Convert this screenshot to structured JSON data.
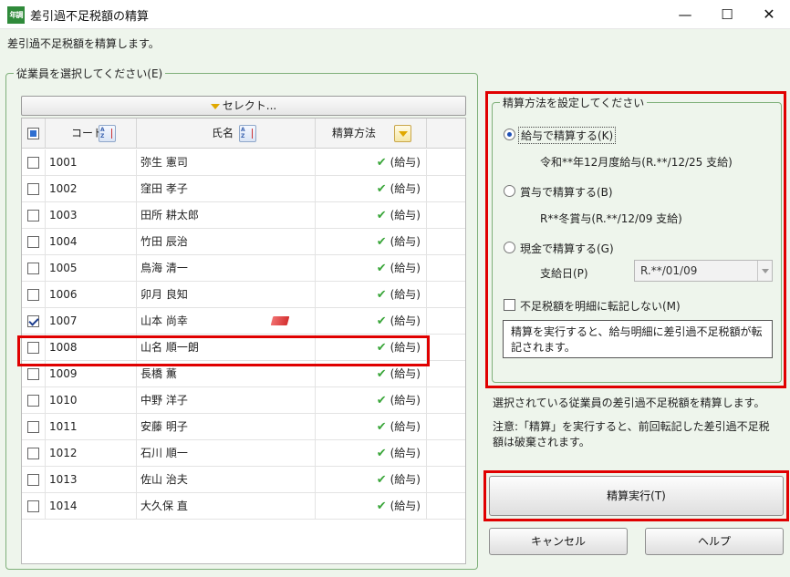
{
  "window": {
    "icon_text": "年調",
    "title": "差引過不足税額の精算",
    "minimize": "—",
    "maximize": "☐",
    "close": "✕"
  },
  "description": "差引過不足税額を精算します。",
  "employee_group": {
    "legend": "従業員を選択してください(E)",
    "select_button": "セレクト...",
    "columns": {
      "code": "コード",
      "name": "氏名",
      "method": "精算方法"
    },
    "rows": [
      {
        "code": "1001",
        "name": "弥生 憲司",
        "method": "(給与)",
        "checked": false
      },
      {
        "code": "1002",
        "name": "窪田 孝子",
        "method": "(給与)",
        "checked": false
      },
      {
        "code": "1003",
        "name": "田所 耕太郎",
        "method": "(給与)",
        "checked": false
      },
      {
        "code": "1004",
        "name": "竹田 辰治",
        "method": "(給与)",
        "checked": false
      },
      {
        "code": "1005",
        "name": "鳥海 清一",
        "method": "(給与)",
        "checked": false
      },
      {
        "code": "1006",
        "name": "卯月 良知",
        "method": "(給与)",
        "checked": false
      },
      {
        "code": "1007",
        "name": "山本 尚幸",
        "method": "(給与)",
        "checked": true
      },
      {
        "code": "1008",
        "name": "山名 順一朗",
        "method": "(給与)",
        "checked": false
      },
      {
        "code": "1009",
        "name": "長橋 薫",
        "method": "(給与)",
        "checked": false
      },
      {
        "code": "1010",
        "name": "中野 洋子",
        "method": "(給与)",
        "checked": false
      },
      {
        "code": "1011",
        "name": "安藤 明子",
        "method": "(給与)",
        "checked": false
      },
      {
        "code": "1012",
        "name": "石川 順一",
        "method": "(給与)",
        "checked": false
      },
      {
        "code": "1013",
        "name": "佐山 治夫",
        "method": "(給与)",
        "checked": false
      },
      {
        "code": "1014",
        "name": "大久保 直",
        "method": "(給与)",
        "checked": false
      }
    ]
  },
  "method_group": {
    "legend": "精算方法を設定してください",
    "salary_label": "給与で精算する(K)",
    "salary_detail": "令和**年12月度給与(R.**/12/25 支給)",
    "bonus_label": "賞与で精算する(B)",
    "bonus_detail": "R**冬賞与(R.**/12/09 支給)",
    "cash_label": "現金で精算する(G)",
    "pay_date_label": "支給日(P)",
    "pay_date_value": "R.**/01/09",
    "no_transfer_label": "不足税額を明細に転記しない(M)",
    "note": "精算を実行すると、給与明細に差引過不足税額が転記されます。"
  },
  "info_text_1": "選択されている従業員の差引過不足税額を精算します。",
  "info_text_2": "注意:「精算」を実行すると、前回転記した差引過不足税額は破棄されます。",
  "buttons": {
    "execute": "精算実行(T)",
    "cancel": "キャンセル",
    "help": "ヘルプ"
  }
}
